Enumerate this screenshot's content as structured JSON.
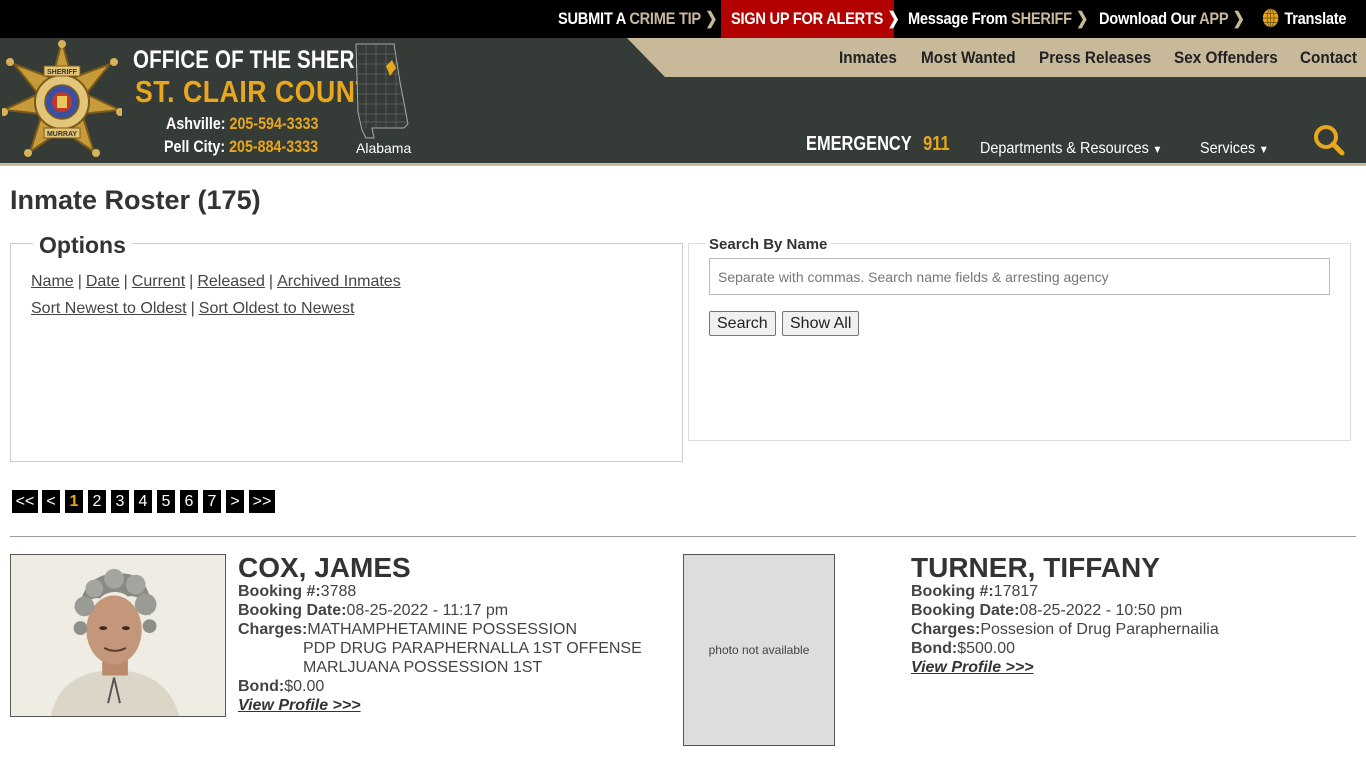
{
  "topbar": {
    "crime_tip_a": "SUBMIT A",
    "crime_tip_b": "CRIME TIP",
    "alerts": "SIGN UP FOR ALERTS",
    "message_a": "Message From",
    "message_b": "SHERIFF",
    "app_a": "Download Our",
    "app_b": "APP",
    "translate": "Translate"
  },
  "header": {
    "office": "OFFICE OF THE SHERIFF",
    "county": "ST. CLAIR COUNTY",
    "phone1_label": "Ashville:",
    "phone1": "205-594-3333",
    "phone2_label": "Pell City:",
    "phone2": "205-884-3333",
    "state": "Alabama",
    "badge_top": "SHERIFF",
    "badge_bottom": "MURRAY",
    "emergency_label": "EMERGENCY",
    "emergency_num": "911",
    "nav": [
      "Inmates",
      "Most Wanted",
      "Press Releases",
      "Sex Offenders",
      "Contact"
    ],
    "dropdowns": [
      "Departments & Resources",
      "Services"
    ]
  },
  "page": {
    "title": "Inmate Roster (175)"
  },
  "options": {
    "legend": "Options",
    "sort_links": [
      "Name",
      "Date",
      "Current",
      "Released",
      "Archived Inmates"
    ],
    "order_links": [
      "Sort Newest to Oldest",
      "Sort Oldest to Newest"
    ]
  },
  "search": {
    "legend": "Search By Name",
    "placeholder": "Separate with commas. Search name fields & arresting agency",
    "search_label": "Search",
    "show_all_label": "Show All"
  },
  "pager": {
    "first": "<<",
    "prev": "<",
    "pages": [
      "1",
      "2",
      "3",
      "4",
      "5",
      "6",
      "7"
    ],
    "current": "1",
    "next": ">",
    "last": ">>"
  },
  "inmates": [
    {
      "name": "COX, JAMES",
      "booking_label": "Booking #:",
      "booking": "3788",
      "date_label": "Booking Date:",
      "date": "08-25-2022 - 11:17 pm",
      "charges_label": "Charges:",
      "charges": [
        "MATHAMPHETAMINE POSSESSION",
        "PDP DRUG PARAPHERNALLA 1ST OFFENSE",
        "MARLJUANA POSSESSION 1ST"
      ],
      "bond_label": "Bond:",
      "bond": "$0.00",
      "view": "View Profile >>>"
    },
    {
      "name": "TURNER, TIFFANY",
      "photo_text": "photo not available",
      "booking_label": "Booking #:",
      "booking": "17817",
      "date_label": "Booking Date:",
      "date": "08-25-2022 - 10:50 pm",
      "charges_label": "Charges:",
      "charges": [
        "Possesion of Drug Paraphernailia"
      ],
      "bond_label": "Bond:",
      "bond": "$500.00",
      "view": "View Profile >>>"
    }
  ],
  "colors": {
    "header_bg": "#353b36",
    "accent_gold": "#e8a71c",
    "tan": "#c9b99b",
    "alert_red": "#b30000"
  }
}
